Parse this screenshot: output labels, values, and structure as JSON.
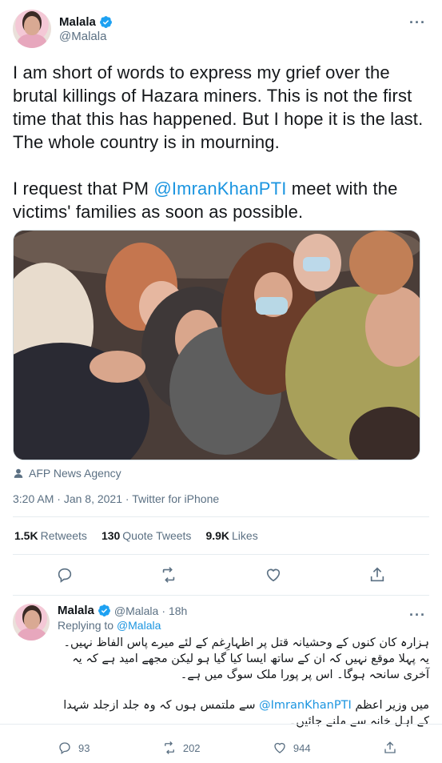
{
  "main_tweet": {
    "display_name": "Malala",
    "handle": "@Malala",
    "text_part1": "I am short of words to express my grief over the brutal killings of Hazara miners. This is not the first time that this has happened. But I hope it is the last. The whole country is in mourning.\n\nI request that PM ",
    "mention": "@ImranKhanPTI",
    "text_part2": " meet with the victims' families as soon as possible.",
    "photo_credit": "AFP News Agency",
    "time": "3:20 AM",
    "date": "Jan 8, 2021",
    "source": "Twitter for iPhone",
    "retweets_count": "1.5K",
    "retweets_label": "Retweets",
    "quotes_count": "130",
    "quotes_label": "Quote Tweets",
    "likes_count": "9.9K",
    "likes_label": "Likes"
  },
  "reply_tweet": {
    "display_name": "Malala",
    "handle": "@Malala",
    "age": "18h",
    "replying_label": "Replying to",
    "replying_to": "@Malala",
    "text_para1": "ہزارہ کان کنوں کے وحشیانہ قتل پر اظہارِغم کے لئے میرے پاس الفاظ نہیں۔ یہ پہلا موقع نہیں کہ ان کے ساتھ ایسا کیا گیا ہو لیکن مجھے امید ہے کہ یہ آخری سانحہ ہوگا۔ اس پر پورا ملک سوگ میں ہے۔",
    "text_part_a": "میں وزیر اعظم ",
    "mention": "@ImranKhanPTI",
    "text_part_b": " سے ملتمس ہوں کہ وہ جلد ازجلد شہدا کے اہل خانہ سے ملنے جائیں۔",
    "reply_count": "93",
    "retweet_count": "202",
    "like_count": "944"
  },
  "colors": {
    "accent": "#1b95e0",
    "secondary_text": "#5b7083",
    "divider": "#e6ecf0"
  },
  "icons": [
    "more-icon",
    "verified-badge-icon",
    "camera-icon",
    "reply-icon",
    "retweet-icon",
    "like-icon",
    "share-icon"
  ]
}
